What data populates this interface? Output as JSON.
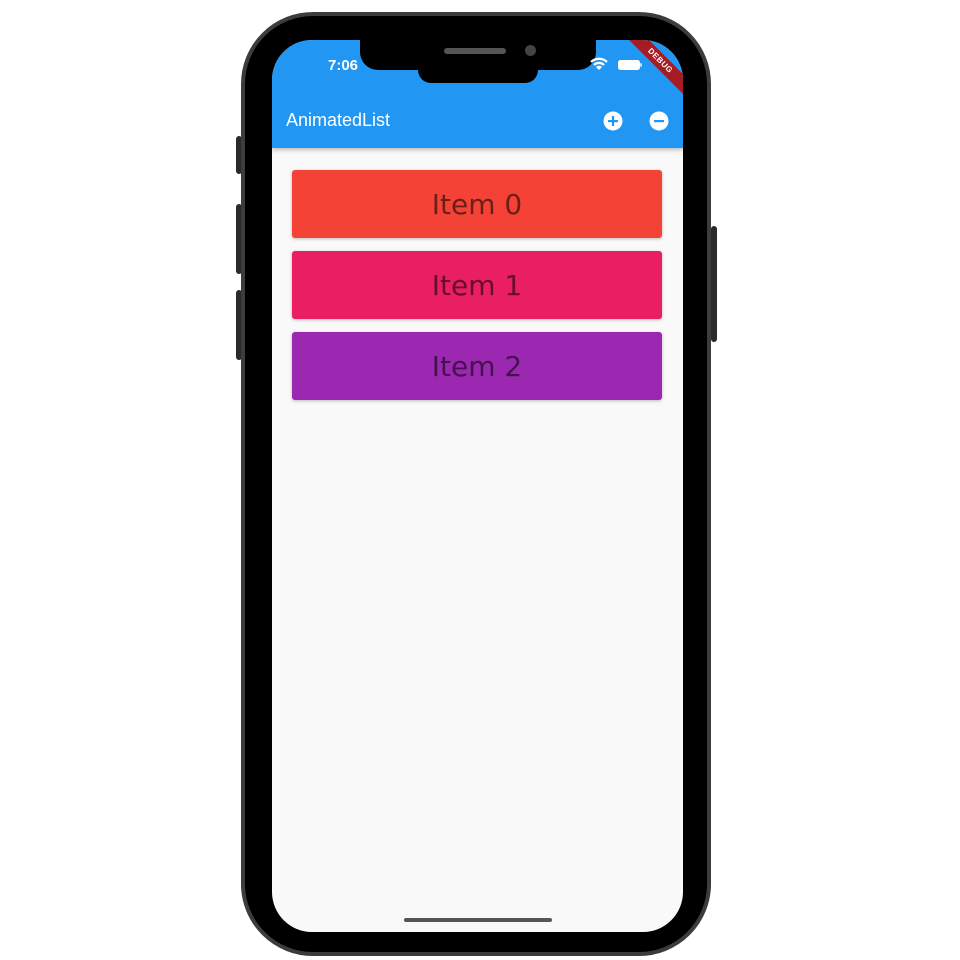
{
  "status_bar": {
    "time": "7:06",
    "wifi_icon": "wifi-icon",
    "battery_icon": "battery-icon"
  },
  "debug_banner": {
    "label": "DEBUG"
  },
  "app_bar": {
    "title": "AnimatedList",
    "background": "#2196f3",
    "actions": [
      {
        "icon": "add-circle-icon"
      },
      {
        "icon": "remove-circle-icon"
      }
    ]
  },
  "list": {
    "items": [
      {
        "label": "Item 0",
        "color": "#f44336"
      },
      {
        "label": "Item 1",
        "color": "#e91e63"
      },
      {
        "label": "Item 2",
        "color": "#9c27b0"
      }
    ]
  }
}
